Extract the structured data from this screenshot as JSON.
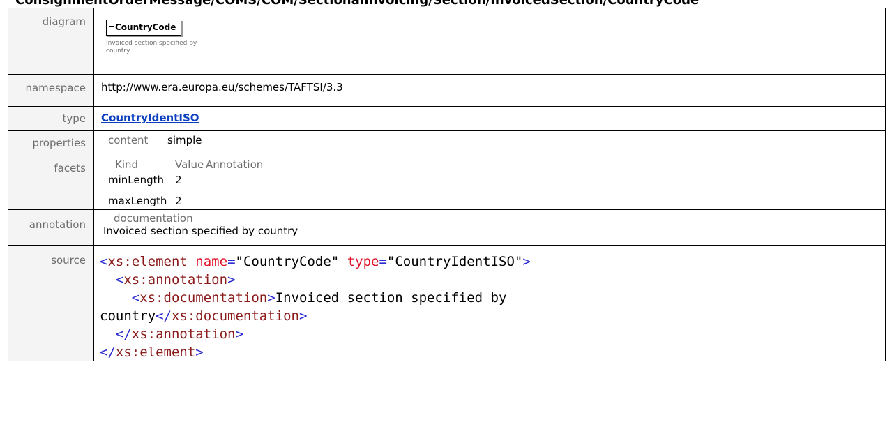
{
  "heading": "ConsignmentOrderMessage/COMS/COM/SectionalInvoicing/Section/InvoicedSection/CountryCode",
  "rows": {
    "diagram": {
      "label": "diagram",
      "element_name": "CountryCode",
      "element_doc": "Invoiced section specified by country"
    },
    "namespace": {
      "label": "namespace",
      "value": "http://www.era.europa.eu/schemes/TAFTSI/3.3"
    },
    "type": {
      "label": "type",
      "value": "CountryIdentISO"
    },
    "properties": {
      "label": "properties",
      "key": "content",
      "value": "simple"
    },
    "facets": {
      "label": "facets",
      "headers": [
        "Kind",
        "Value",
        "Annotation"
      ],
      "items": [
        {
          "kind": "minLength",
          "value": "2",
          "annotation": ""
        },
        {
          "kind": "maxLength",
          "value": "2",
          "annotation": ""
        }
      ]
    },
    "annotation": {
      "label": "annotation",
      "key": "documentation",
      "value": "Invoiced section specified by country"
    },
    "source": {
      "label": "source",
      "element_tag": "xs:element",
      "attr_name": "name",
      "attr_name_val": "\"CountryCode\"",
      "attr_type": "type",
      "attr_type_val": "\"CountryIdentISO\"",
      "annotation_tag": "xs:annotation",
      "documentation_tag": "xs:documentation",
      "doc_text_1": "Invoiced section specified by",
      "doc_text_2": "country"
    }
  }
}
